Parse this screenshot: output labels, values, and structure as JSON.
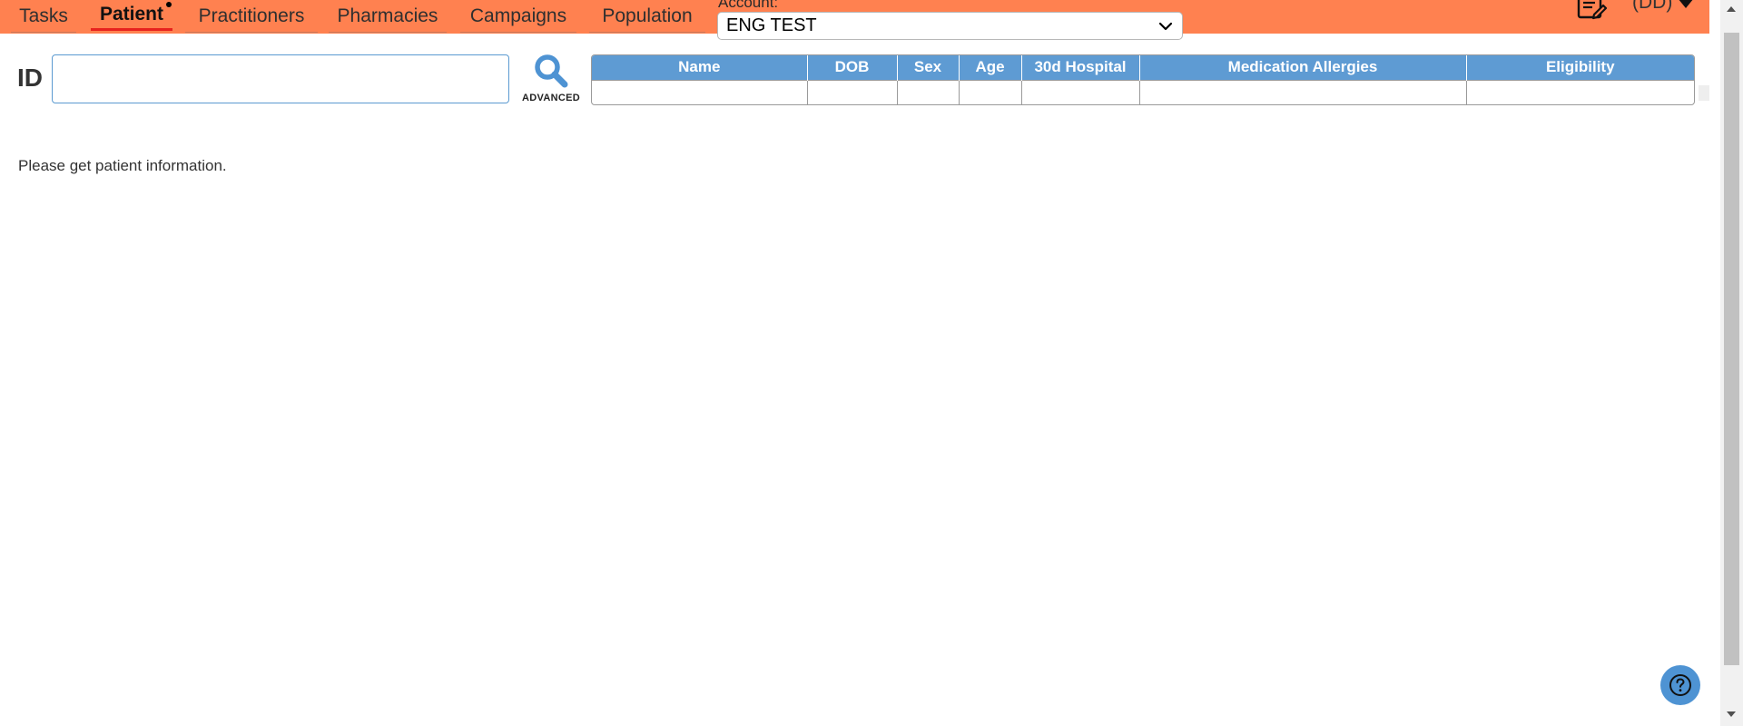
{
  "nav": {
    "tabs": [
      {
        "label": "Tasks",
        "active": false
      },
      {
        "label": "Patient",
        "active": true
      },
      {
        "label": "Practitioners",
        "active": false
      },
      {
        "label": "Pharmacies",
        "active": false
      },
      {
        "label": "Campaigns",
        "active": false
      },
      {
        "label": "Population",
        "active": false
      }
    ]
  },
  "account": {
    "label": "Account:",
    "selected": "ENG TEST"
  },
  "user": {
    "label": "(DD)"
  },
  "search": {
    "id_label": "ID",
    "id_value": "",
    "advanced_label": "ADVANCED"
  },
  "results_table": {
    "columns": [
      "Name",
      "DOB",
      "Sex",
      "Age",
      "30d Hospital",
      "Medication Allergies",
      "Eligibility"
    ],
    "rows": []
  },
  "message": "Please get patient information.",
  "colors": {
    "topbar": "#ff8150",
    "active_tab_underline": "#e8221e",
    "table_header": "#5e9bd3",
    "accent_blue": "#4e93d3"
  },
  "icons": {
    "search": "search-icon",
    "notes": "edit-note-icon",
    "help": "help-icon",
    "dropdown": "chevron-down-icon",
    "user_caret": "caret-down-icon"
  }
}
